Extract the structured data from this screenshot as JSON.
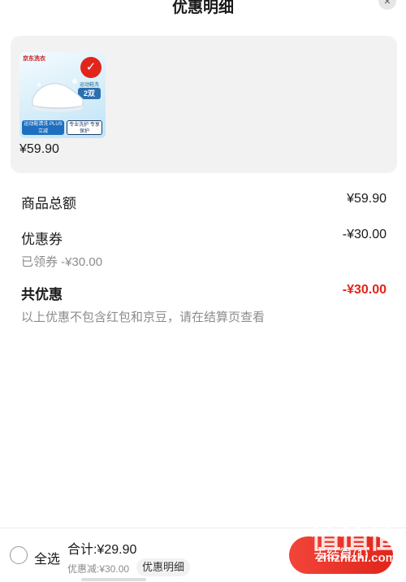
{
  "sheet": {
    "title": "优惠明细",
    "close_glyph": "×"
  },
  "product": {
    "thumbnail": {
      "brand": "京东洗衣",
      "tag": "运动鞋洗",
      "count": "2双",
      "chip_a": "运动鞋清洗 PLUS立减",
      "chip_b": "专业洗护 专享保护"
    },
    "price": "¥59.90"
  },
  "breakdown": {
    "subtotal_label": "商品总额",
    "subtotal_amount": "¥59.90",
    "coupon_label": "优惠券",
    "coupon_amount": "-¥30.00",
    "coupon_note": "已领券 -¥30.00",
    "total_discount_label": "共优惠",
    "total_discount_amount": "-¥30.00",
    "disclaimer": "以上优惠不包含红包和京豆，请在结算页查看"
  },
  "bottom_bar": {
    "select_all_label": "全选",
    "total_label": "合计:¥29.90",
    "discount_label": "优惠减:¥30.00",
    "detail_button": "优惠明细",
    "checkout_button": "去结算(1)"
  },
  "watermark": {
    "logo": "值值值",
    "url": "zhizhizhi.com"
  },
  "colors": {
    "accent": "#e1251b",
    "card_bg": "#f2f2f2",
    "muted_text": "#8c8c8c"
  }
}
